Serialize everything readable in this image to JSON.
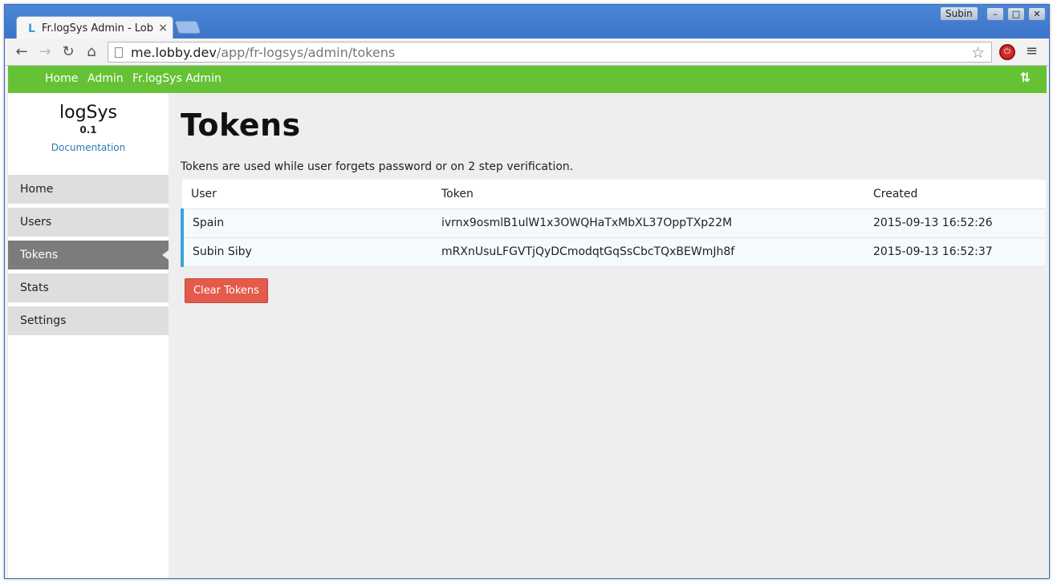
{
  "browser": {
    "tab_title": "Fr.logSys Admin - Lobby",
    "tab_favicon": "L",
    "profile_name": "Subin",
    "url_host": "me.lobby.dev",
    "url_path": "/app/fr-logsys/admin/tokens",
    "icons": [
      "back-icon",
      "forward-icon",
      "reload-icon",
      "home-icon",
      "page-icon",
      "star-icon",
      "extension-icon",
      "menu-icon"
    ]
  },
  "navbar": {
    "links": [
      "Home",
      "Admin",
      "Fr.logSys Admin"
    ],
    "color": "#65c235"
  },
  "sidebar": {
    "app_name": "logSys",
    "version": "0.1",
    "doc_link": "Documentation",
    "items": [
      {
        "label": "Home"
      },
      {
        "label": "Users"
      },
      {
        "label": "Tokens"
      },
      {
        "label": "Stats"
      },
      {
        "label": "Settings"
      }
    ],
    "active": "Tokens"
  },
  "main": {
    "title": "Tokens",
    "description": "Tokens are used while user forgets password or on 2 step verification.",
    "table": {
      "headers": [
        "User",
        "Token",
        "Created"
      ],
      "rows": [
        [
          "Spain",
          "ivrnx9osmlB1ulW1x3OWQHaTxMbXL37OppTXp22M",
          "2015-09-13 16:52:26"
        ],
        [
          "Subin Siby",
          "mRXnUsuLFGVTjQyDCmodqtGqSsCbcTQxBEWmJh8f",
          "2015-09-13 16:52:37"
        ]
      ]
    },
    "clear_button": "Clear Tokens"
  }
}
